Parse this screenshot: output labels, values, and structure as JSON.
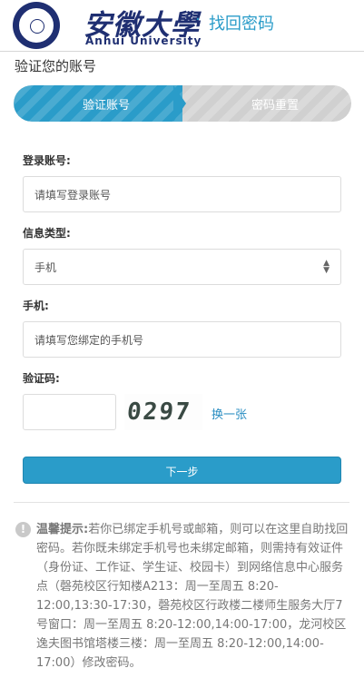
{
  "header": {
    "university_cn": "安徽大學",
    "university_en": "Anhui University",
    "separator": "·",
    "page_title": "找回密码"
  },
  "section_title": "验证您的账号",
  "steps": [
    "验证账号",
    "密码重置"
  ],
  "form": {
    "account_label": "登录账号:",
    "account_placeholder": "请填写登录账号",
    "info_type_label": "信息类型:",
    "info_type_value": "手机",
    "phone_label": "手机:",
    "phone_placeholder": "请填写您绑定的手机号",
    "captcha_label": "验证码:",
    "captcha_text": "0297",
    "refresh_captcha": "换一张",
    "next_button": "下一步"
  },
  "notice": {
    "lead": "温馨提示:",
    "text": "若你已绑定手机号或邮箱，则可以在这里自助找回密码。若你既未绑定手机号也未绑定邮箱，则需持有效证件（身份证、工作证、学生证、校园卡）到网络信息中心服务点（磬苑校区行知楼A213：周一至周五 8:20-12:00,13:30-17:30，磬苑校区行政楼二楼师生服务大厅7号窗口：周一至周五 8:20-12:00,14:00-17:00，龙河校区逸夫图书馆塔楼三楼：周一至周五 8:20-12:00,14:00-17:00）修改密码。"
  },
  "colors": {
    "accent": "#2a9cc9",
    "brand_navy": "#1f2f72",
    "inactive_step": "#d0d0d0",
    "link": "#2a8ec2"
  },
  "icons": {
    "info": "info-circle-icon",
    "select": "select-updown-icon"
  }
}
